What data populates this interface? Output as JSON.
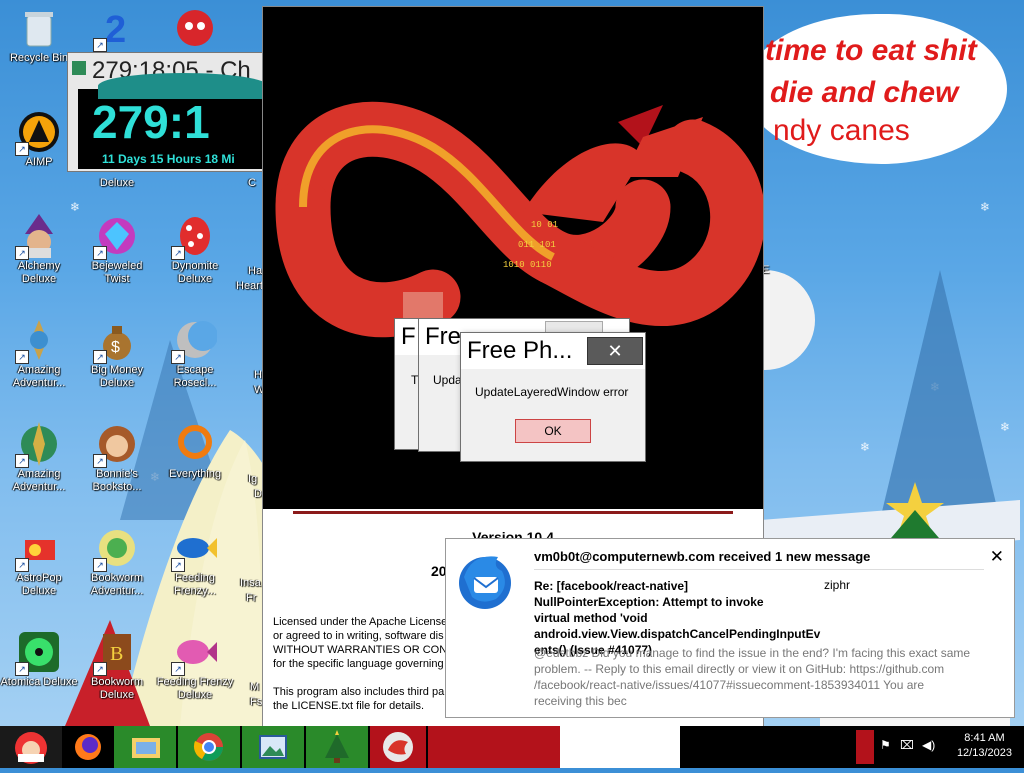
{
  "desktop_icons": [
    {
      "id": "recycle-bin",
      "label": "Recycle Bin"
    },
    {
      "id": "aimp",
      "label": "AIMP"
    },
    {
      "id": "alchemy-deluxe",
      "label": "Alchemy Deluxe"
    },
    {
      "id": "bejeweled-twist",
      "label": "Bejeweled Twist"
    },
    {
      "id": "dynomite-deluxe",
      "label": "Dynomite Deluxe"
    },
    {
      "id": "amazing-adventures-1",
      "label": "Amazing Adventur..."
    },
    {
      "id": "big-money-deluxe",
      "label": "Big Money Deluxe"
    },
    {
      "id": "escape-rosecliff",
      "label": "Escape Rosecl..."
    },
    {
      "id": "amazing-adventures-2",
      "label": "Amazing Adventur..."
    },
    {
      "id": "bonnies-bookstore",
      "label": "Bonnie's Booksto..."
    },
    {
      "id": "everything",
      "label": "Everything"
    },
    {
      "id": "astropop-deluxe",
      "label": "AstroPop Deluxe"
    },
    {
      "id": "bookworm-adventures",
      "label": "Bookworm Adventur..."
    },
    {
      "id": "feeding-frenzy",
      "label": "Feeding Frenzy..."
    },
    {
      "id": "atomica-deluxe",
      "label": "Atomica Deluxe"
    },
    {
      "id": "bookworm-deluxe",
      "label": "Bookworm Deluxe"
    },
    {
      "id": "feeding-frenzy-deluxe",
      "label": "Feeding Frenzy Deluxe"
    }
  ],
  "partial_labels": {
    "deluxe_behind_clock": "Deluxe",
    "c_behind_clock": "C",
    "ha_1": "Ha",
    "heart": "Heart",
    "h_2": "H",
    "w_2": "W",
    "ig": "Ig",
    "d": "D",
    "insa": "Insa",
    "fr": "Fr",
    "m": "M",
    "fs": "Fs",
    "e_right": "E"
  },
  "bubble": {
    "line1": "time to eat shit",
    "line2": "die and chew",
    "line3": "ndy canes"
  },
  "clock_widget": {
    "title": "279:18:05 - Ch",
    "display": "279:1",
    "subtitle": "11 Days 15 Hours 18 Mi"
  },
  "splash": {
    "version": "Version 10.4",
    "year": "20",
    "license_lines": [
      "Licensed under the Apache License,",
      "or agreed to in writing, software dis",
      "WITHOUT WARRANTIES OR CONDI",
      "for the specific language governing",
      "",
      "This program also includes third part",
      "the LICENSE.txt file for details."
    ]
  },
  "back_dialog_1": {
    "title": "F",
    "text": "Tl"
  },
  "back_dialog_2": {
    "title": "Fre",
    "text": "Upda"
  },
  "error_dialog": {
    "title": "Free Ph...",
    "message": "UpdateLayeredWindow error",
    "ok_label": "OK"
  },
  "notification": {
    "header": "vm0b0t@computernewb.com received 1 new message",
    "subject": "Re: [facebook/react-native] NullPointerException: Attempt to invoke virtual method 'void android.view.View.dispatchCancelPendingInputEv ents() (Issue #41077)",
    "sender": "ziphr",
    "body": "@edstbbz Did you manage to find the issue in the end? I'm facing this exact same problem. -- Reply to this email directly or view it on GitHub: https://github.com /facebook/react-native/issues/41077#issuecomment-1853934011 You are receiving this bec",
    "close_glyph": "✕"
  },
  "taskbar": {
    "time": "8:41 AM",
    "date": "12/13/2023"
  },
  "colors": {
    "accent_red": "#e01b1b",
    "clock_cyan": "#2fe0d8",
    "taskbar_green": "#2a8a2a",
    "taskbar_red": "#b3121b"
  }
}
